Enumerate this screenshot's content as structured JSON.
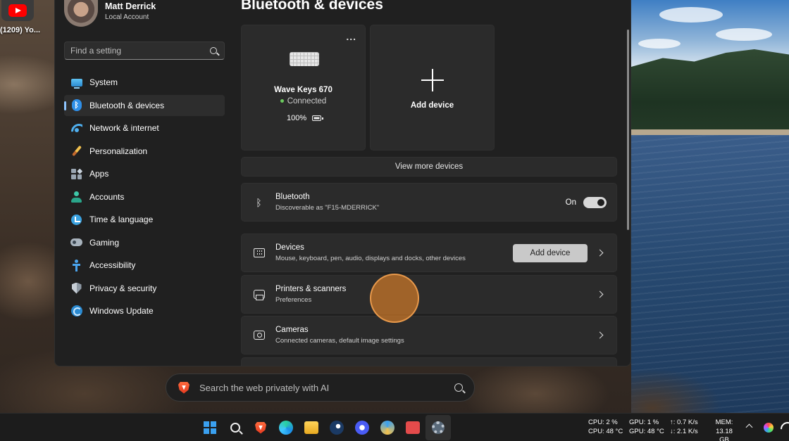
{
  "desktop": {
    "shortcut_label": "(1209) Yo..."
  },
  "profile": {
    "name": "Matt Derrick",
    "account_type": "Local Account"
  },
  "search": {
    "placeholder": "Find a setting"
  },
  "sidebar": {
    "items": [
      {
        "label": "System",
        "icon": "system-icon"
      },
      {
        "label": "Bluetooth & devices",
        "icon": "bluetooth-icon",
        "active": true
      },
      {
        "label": "Network & internet",
        "icon": "wifi-icon"
      },
      {
        "label": "Personalization",
        "icon": "brush-icon"
      },
      {
        "label": "Apps",
        "icon": "apps-icon"
      },
      {
        "label": "Accounts",
        "icon": "person-icon"
      },
      {
        "label": "Time & language",
        "icon": "clock-globe-icon"
      },
      {
        "label": "Gaming",
        "icon": "gamepad-icon"
      },
      {
        "label": "Accessibility",
        "icon": "accessibility-icon"
      },
      {
        "label": "Privacy & security",
        "icon": "shield-icon"
      },
      {
        "label": "Windows Update",
        "icon": "update-icon"
      }
    ]
  },
  "main": {
    "title": "Bluetooth & devices",
    "device_card": {
      "more": "...",
      "name": "Wave Keys 670",
      "status": "Connected",
      "battery": "100%"
    },
    "add_card": {
      "label": "Add device"
    },
    "view_more": "View more devices",
    "bluetooth": {
      "title": "Bluetooth",
      "subtitle": "Discoverable as \"F15-MDERRICK\"",
      "state_label": "On",
      "enabled": true
    },
    "devices_row": {
      "title": "Devices",
      "subtitle": "Mouse, keyboard, pen, audio, displays and docks, other devices",
      "button": "Add device"
    },
    "printers_row": {
      "title": "Printers & scanners",
      "subtitle": "Preferences"
    },
    "cameras_row": {
      "title": "Cameras",
      "subtitle": "Connected cameras, default image settings"
    }
  },
  "web_search": {
    "placeholder": "Search the web privately with AI"
  },
  "taskbar": {
    "apps": [
      "start-icon",
      "search-icon",
      "brave-icon",
      "edge-icon",
      "file-explorer-icon",
      "steam-icon",
      "app-icon",
      "todo-icon",
      "todoist-icon",
      "settings-icon"
    ],
    "stats": {
      "cpu_usage": "CPU: 2 %",
      "cpu_temp": "CPU: 48 °C",
      "gpu_usage": "GPU: 1 %",
      "gpu_temp": "GPU: 48 °C",
      "net_up": "↑: 0.7 K/s",
      "net_down": "↓: 2.1 K/s",
      "mem_label": "MEM:",
      "mem_value": "13.18 GB"
    }
  }
}
